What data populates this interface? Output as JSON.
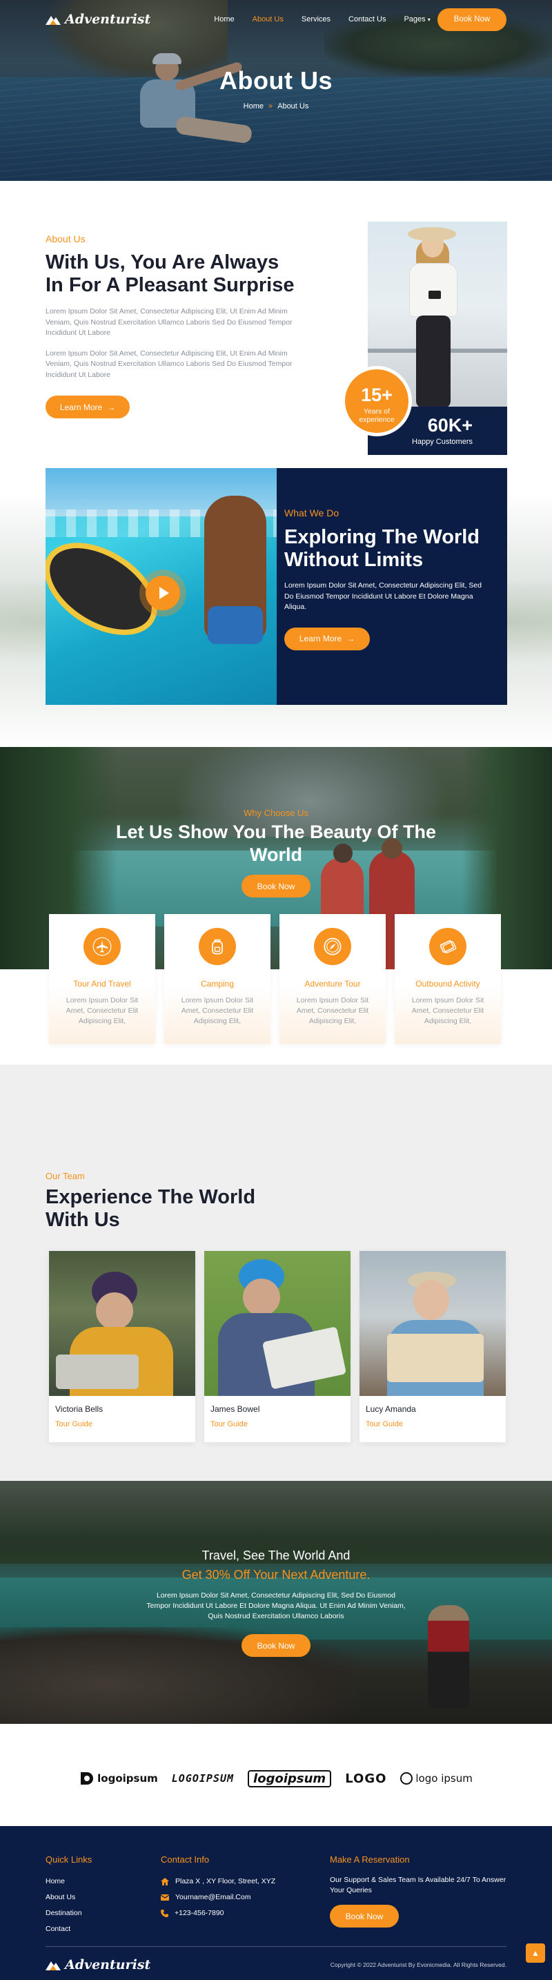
{
  "brand": {
    "name": "Adventurist"
  },
  "nav": {
    "items": [
      {
        "label": "Home",
        "active": false
      },
      {
        "label": "About Us",
        "active": true
      },
      {
        "label": "Services",
        "active": false
      },
      {
        "label": "Contact Us",
        "active": false
      },
      {
        "label": "Pages",
        "active": false
      }
    ],
    "book_label": "Book Now"
  },
  "hero": {
    "title": "About Us",
    "breadcrumb_home": "Home",
    "breadcrumb_sep": "»",
    "breadcrumb_current": "About Us"
  },
  "about": {
    "eyebrow": "About Us",
    "title": "With Us, You Are Always In For A Pleasant Surprise",
    "para1": "Lorem Ipsum Dolor Sit Amet, Consectetur Adipiscing Elit, Ut Enim Ad Minim Veniam, Quis Nostrud Exercitation Ullamco Laboris Sed Do Eiusmod Tempor Incididunt Ut Labore",
    "para2": "Lorem Ipsum Dolor Sit Amet, Consectetur Adipiscing Elit, Ut Enim Ad Minim Veniam, Quis Nostrud Exercitation Ullamco Laboris Sed Do Eiusmod Tempor Incididunt Ut Labore",
    "button": "Learn More",
    "badge_number": "15+",
    "badge_text": "Years of experience",
    "stat_number": "60K+",
    "stat_label": "Happy Customers"
  },
  "what_we_do": {
    "eyebrow": "What We Do",
    "title": "Exploring The World Without Limits",
    "para": "Lorem Ipsum Dolor Sit Amet, Consectetur Adipiscing Elit, Sed Do Eiusmod Tempor Incididunt Ut Labore Et Dolore Magna Aliqua.",
    "button": "Learn More"
  },
  "why": {
    "eyebrow": "Why Choose Us",
    "title": "Let Us Show You The Beauty Of The World",
    "button": "Book Now",
    "cards": [
      {
        "title": "Tour And Travel",
        "text": "Lorem Ipsum Dolor Sit Amet, Consectetur Elit Adipiscing Elit,",
        "icon": "plane-icon"
      },
      {
        "title": "Camping",
        "text": "Lorem Ipsum Dolor Sit Amet, Consectetur Elit Adipiscing Elit,",
        "icon": "backpack-icon"
      },
      {
        "title": "Adventure Tour",
        "text": "Lorem Ipsum Dolor Sit Amet, Consectetur Elit Adipiscing Elit,",
        "icon": "compass-icon"
      },
      {
        "title": "Outbound Activity",
        "text": "Lorem Ipsum Dolor Sit Amet, Consectetur Elit Adipiscing Elit,",
        "icon": "ticket-icon"
      }
    ]
  },
  "team": {
    "eyebrow": "Our Team",
    "title": "Experience The World With Us",
    "members": [
      {
        "name": "Victoria Bells",
        "role": "Tour Guide"
      },
      {
        "name": "James Bowel",
        "role": "Tour Guide"
      },
      {
        "name": "Lucy Amanda",
        "role": "Tour Guide"
      }
    ]
  },
  "promo": {
    "line1": "Travel, See The World And",
    "line2": "Get 30% Off Your Next Adventure.",
    "para": "Lorem Ipsum Dolor Sit Amet, Consectetur Adipiscing Elit, Sed Do Eiusmod Tempor Incididunt Ut Labore Et Dolore Magna Aliqua. Ut Enim Ad Minim Veniam, Quis Nostrud Exercitation Ullamco Laboris",
    "button": "Book Now"
  },
  "partners": [
    "logoipsum",
    "LOGOIPSUM",
    "logoipsum",
    "LOGO",
    "logo ipsum"
  ],
  "footer": {
    "quick_links_title": "Quick Links",
    "quick_links": [
      "Home",
      "About Us",
      "Destination",
      "Contact"
    ],
    "contact_title": "Contact Info",
    "address": "Plaza X , XY Floor, Street, XYZ",
    "email": "Yourname@Email.Com",
    "phone": "+123-456-7890",
    "reservation_title": "Make A Reservation",
    "reservation_text": "Our Support & Sales Team Is Available 24/7 To Answer Your Queries",
    "reservation_button": "Book Now",
    "copyright": "Copyright © 2022 Adventurist By Evonicmedia. All Rights Reserved."
  },
  "colors": {
    "accent": "#f7931e",
    "navy": "#0c1d45"
  }
}
